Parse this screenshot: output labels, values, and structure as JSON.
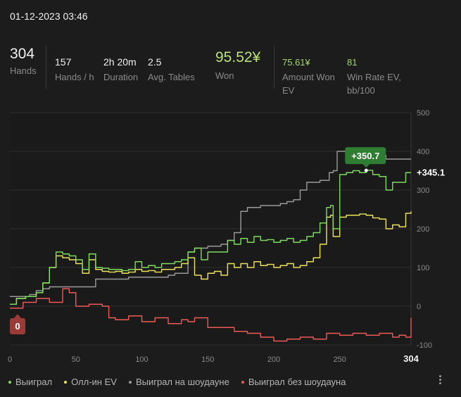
{
  "header": {
    "datetime": "01-12-2023 03:46"
  },
  "stats": {
    "hands": {
      "value": "304",
      "label": "Hands"
    },
    "hands_per_hour": {
      "value": "157",
      "label": "Hands / h"
    },
    "duration": {
      "value": "2h 20m",
      "label": "Duration"
    },
    "avg_tables": {
      "value": "2.5",
      "label": "Avg. Tables"
    },
    "won": {
      "value": "95.52¥",
      "label": "Won"
    },
    "amount_won_ev": {
      "value": "75.61¥",
      "label_line1": "Amount Won",
      "label_line2": "EV"
    },
    "win_rate_ev": {
      "value": "81",
      "label_line1": "Win Rate EV,",
      "label_line2": "bb/100"
    }
  },
  "colors": {
    "won": "#7ddc5e",
    "allin_ev": "#ece35a",
    "showdown": "#9a9a9a",
    "non_showdown": "#ee5a55",
    "tooltip_bg": "#2e7d32",
    "start_badge_bg": "#9b3b38"
  },
  "legend": [
    {
      "label": "Выиграл",
      "color": "#7ddc5e"
    },
    {
      "label": "Олл-ин EV",
      "color": "#ece35a"
    },
    {
      "label": "Выиграл на шоудауне",
      "color": "#9a9a9a"
    },
    {
      "label": "Выиграл без шоудауна",
      "color": "#ee5a55"
    }
  ],
  "menu_icon": "kebab-menu-icon",
  "chart_data": {
    "type": "line",
    "xlim": [
      0,
      304
    ],
    "ylim": [
      -100,
      500
    ],
    "x_ticks": [
      "0",
      "50",
      "100",
      "150",
      "200",
      "250",
      "304"
    ],
    "y_ticks": [
      "500",
      "400",
      "300",
      "200",
      "100",
      "0",
      "-100"
    ],
    "annotations": {
      "peak_label": "+350.7",
      "peak_x": 270,
      "peak_y": 350.7,
      "end_label": "+345.1",
      "start_label": "0"
    },
    "series": [
      {
        "name": "Выиграл",
        "color": "#7ddc5e",
        "x": [
          0,
          5,
          12,
          20,
          25,
          30,
          35,
          40,
          45,
          50,
          55,
          60,
          65,
          70,
          75,
          80,
          85,
          90,
          95,
          100,
          105,
          110,
          115,
          120,
          125,
          130,
          135,
          140,
          145,
          150,
          155,
          160,
          165,
          170,
          175,
          180,
          185,
          190,
          195,
          200,
          205,
          210,
          215,
          220,
          225,
          230,
          235,
          240,
          243,
          245,
          250,
          255,
          260,
          265,
          270,
          275,
          280,
          285,
          290,
          295,
          300,
          304
        ],
        "y": [
          5,
          20,
          25,
          35,
          60,
          100,
          140,
          135,
          130,
          120,
          95,
          135,
          100,
          98,
          95,
          95,
          92,
          95,
          115,
          100,
          105,
          100,
          110,
          110,
          115,
          120,
          140,
          150,
          120,
          140,
          140,
          140,
          170,
          160,
          175,
          165,
          180,
          170,
          172,
          165,
          170,
          175,
          165,
          170,
          180,
          190,
          215,
          255,
          260,
          200,
          340,
          345,
          350,
          345,
          351,
          340,
          335,
          300,
          320,
          320,
          345,
          345
        ]
      },
      {
        "name": "Олл-ин EV",
        "color": "#ece35a",
        "x": [
          0,
          5,
          12,
          20,
          25,
          30,
          35,
          40,
          45,
          50,
          55,
          60,
          65,
          70,
          75,
          80,
          85,
          90,
          95,
          100,
          105,
          110,
          115,
          120,
          125,
          130,
          135,
          140,
          145,
          150,
          155,
          160,
          165,
          170,
          175,
          180,
          185,
          190,
          195,
          200,
          205,
          210,
          215,
          220,
          225,
          230,
          235,
          240,
          243,
          245,
          250,
          255,
          260,
          265,
          270,
          275,
          280,
          285,
          290,
          295,
          300,
          304
        ],
        "y": [
          5,
          20,
          25,
          35,
          60,
          100,
          130,
          125,
          120,
          110,
          85,
          120,
          95,
          90,
          88,
          90,
          85,
          88,
          95,
          90,
          92,
          88,
          95,
          95,
          100,
          110,
          125,
          80,
          70,
          85,
          90,
          80,
          110,
          100,
          110,
          100,
          115,
          105,
          108,
          100,
          105,
          110,
          100,
          105,
          115,
          125,
          160,
          230,
          235,
          180,
          230,
          235,
          235,
          238,
          235,
          228,
          225,
          200,
          210,
          205,
          240,
          245
        ]
      },
      {
        "name": "Выиграл на шоудауне",
        "color": "#9a9a9a",
        "x": [
          0,
          5,
          10,
          15,
          20,
          25,
          30,
          35,
          40,
          45,
          50,
          55,
          60,
          65,
          70,
          75,
          80,
          85,
          90,
          95,
          100,
          105,
          110,
          115,
          120,
          125,
          130,
          135,
          140,
          145,
          150,
          155,
          160,
          165,
          170,
          175,
          180,
          185,
          190,
          195,
          200,
          205,
          210,
          215,
          220,
          225,
          230,
          235,
          240,
          242,
          245,
          248,
          250,
          255,
          260,
          265,
          270,
          275,
          280,
          285,
          290,
          295,
          300,
          304
        ],
        "y": [
          25,
          25,
          25,
          30,
          40,
          45,
          50,
          50,
          50,
          50,
          50,
          50,
          50,
          70,
          70,
          70,
          70,
          70,
          75,
          75,
          75,
          75,
          75,
          75,
          80,
          85,
          85,
          140,
          150,
          150,
          155,
          155,
          160,
          170,
          190,
          245,
          255,
          255,
          260,
          260,
          260,
          265,
          270,
          275,
          300,
          320,
          320,
          325,
          325,
          345,
          350,
          400,
          400,
          400,
          400,
          400,
          400,
          390,
          390,
          380,
          380,
          380,
          380,
          380
        ]
      },
      {
        "name": "Выиграл без шоудауна",
        "color": "#ee5a55",
        "x": [
          0,
          10,
          20,
          30,
          40,
          45,
          50,
          60,
          70,
          75,
          80,
          90,
          100,
          110,
          120,
          130,
          135,
          140,
          150,
          160,
          170,
          180,
          190,
          200,
          210,
          220,
          230,
          240,
          250,
          260,
          270,
          280,
          290,
          295,
          300,
          304
        ],
        "y": [
          -5,
          10,
          20,
          10,
          45,
          35,
          0,
          5,
          0,
          -30,
          -35,
          -25,
          -40,
          -30,
          -45,
          -35,
          -40,
          -30,
          -55,
          -55,
          -65,
          -70,
          -80,
          -90,
          -85,
          -80,
          -85,
          -70,
          -75,
          -70,
          -75,
          -70,
          -80,
          -75,
          -80,
          -30
        ]
      }
    ]
  }
}
